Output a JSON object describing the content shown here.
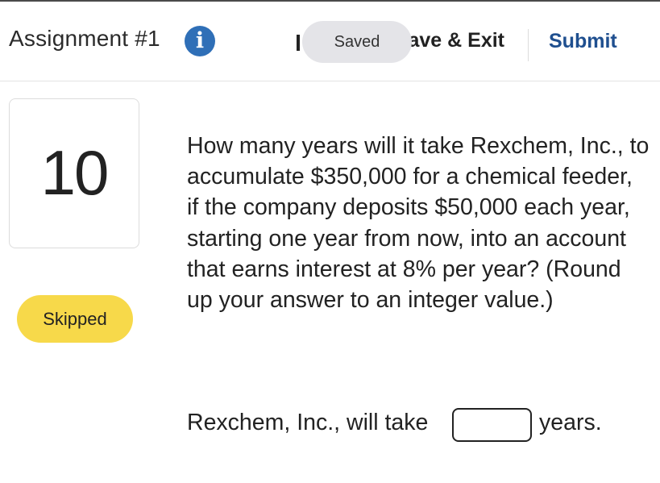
{
  "header": {
    "title": "Assignment #1",
    "info_icon": "info-icon",
    "saved_label": "Saved",
    "save_exit_label": "Save & Exit",
    "submit_label": "Submit"
  },
  "question": {
    "number": "10",
    "status": "Skipped",
    "text": "How many years will it take Rexchem, Inc., to accumulate $350,000 for a chemical feeder, if the company deposits $50,000 each year, starting one year from now, into an account that earns interest at 8% per year? (Round up your answer to an integer value.)",
    "answer_prefix": "Rexchem, Inc., will take",
    "answer_value": "",
    "answer_suffix": "years."
  },
  "colors": {
    "info_icon_bg": "#2f6fb7",
    "submit_text": "#1f4f8f",
    "skipped_badge_bg": "#f7d94a",
    "saved_pill_bg": "#e4e4e8"
  }
}
